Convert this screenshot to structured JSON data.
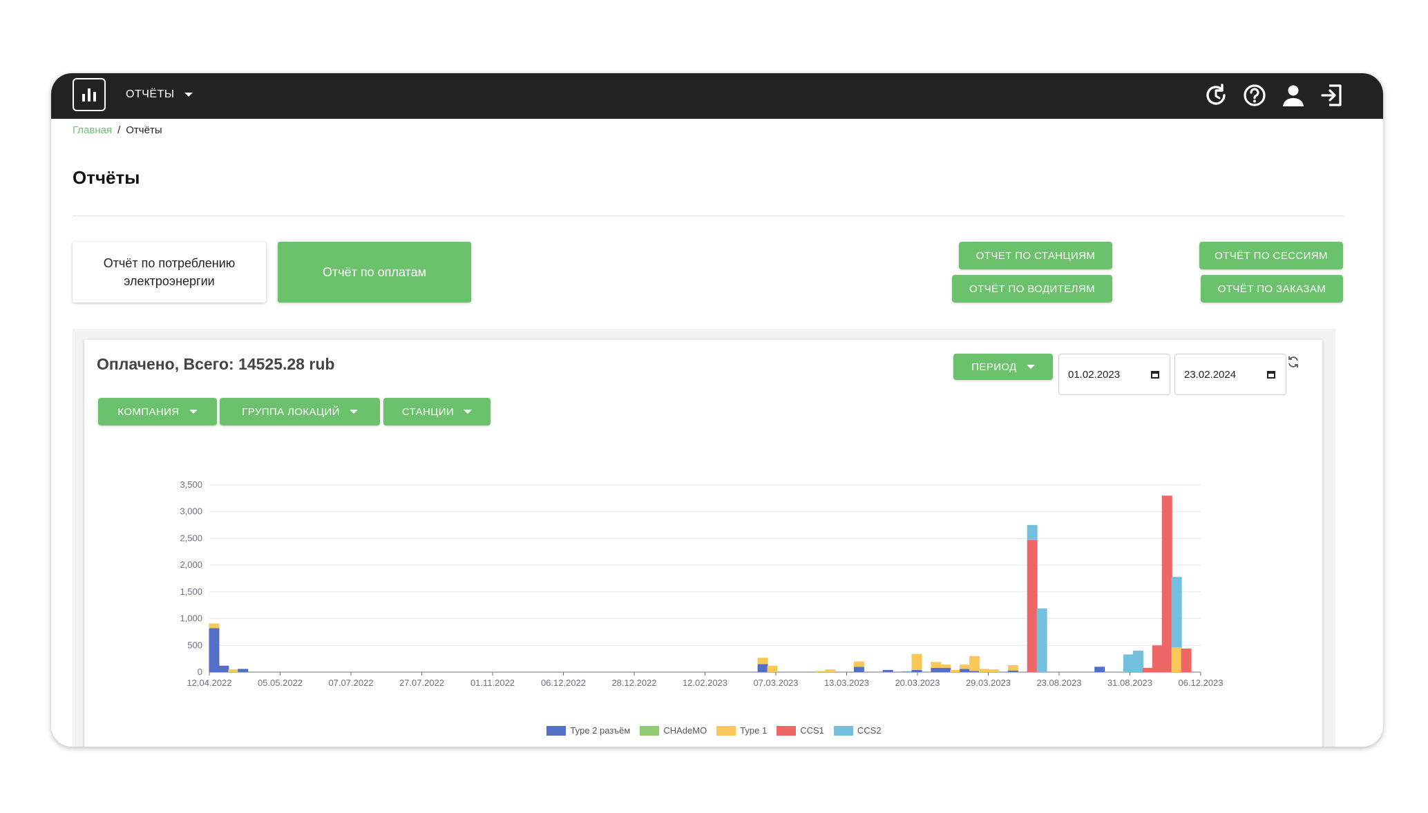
{
  "header": {
    "menu_label": "ОТЧЁТЫ",
    "icons": [
      "history-icon",
      "help-icon",
      "user-icon",
      "logout-icon"
    ]
  },
  "breadcrumb": {
    "home": "Главная",
    "separator": "/",
    "current": "Отчёты"
  },
  "page_title": "Отчёты",
  "tabs": {
    "energy": "Отчёт по потреблению электроэнергии",
    "payments": "Отчёт по оплатам"
  },
  "buttons": {
    "stations": "ОТЧЕТ ПО СТАНЦИЯМ",
    "drivers": "ОТЧЁТ ПО ВОДИТЕЛЯМ",
    "sessions": "ОТЧЁТ ПО СЕССИЯМ",
    "orders": "ОТЧЁТ ПО ЗАКАЗАМ"
  },
  "panel": {
    "title": "Оплачено, Всего: 14525.28 rub",
    "period_label": "ПЕРИОД",
    "date_from": "01.02.2023",
    "date_to": "23.02.2024",
    "filters": {
      "company": "КОМПАНИЯ",
      "location_group": "ГРУППА ЛОКАЦИЙ",
      "stations": "СТАНЦИИ"
    }
  },
  "colors": {
    "accent": "#6cc16c",
    "topbar": "#222222"
  },
  "chart_data": {
    "type": "bar",
    "stacked": true,
    "ylim": [
      0,
      3500
    ],
    "yticks": [
      0,
      500,
      1000,
      1500,
      2000,
      2500,
      3000,
      3500
    ],
    "ytick_labels": [
      "0",
      "500",
      "1,000",
      "1,500",
      "2,000",
      "2,500",
      "3,000",
      "3,500"
    ],
    "xtick_labels": [
      "12.04.2022",
      "05.05.2022",
      "07.07.2022",
      "27.07.2022",
      "01.11.2022",
      "06.12.2022",
      "28.12.2022",
      "12.02.2023",
      "07.03.2023",
      "13.03.2023",
      "20.03.2023",
      "29.03.2023",
      "23.08.2023",
      "31.08.2023",
      "06.12.2023"
    ],
    "grid": true,
    "legend_position": "bottom",
    "series": [
      {
        "name": "Type 2 разъём",
        "color": "#5470c6",
        "values": [
          820,
          120,
          0,
          60,
          0,
          0,
          0,
          0,
          0,
          0,
          0,
          0,
          0,
          0,
          0,
          0,
          0,
          0,
          0,
          0,
          0,
          0,
          0,
          0,
          0,
          0,
          0,
          0,
          0,
          0,
          0,
          0,
          0,
          0,
          0,
          0,
          0,
          0,
          0,
          0,
          0,
          0,
          0,
          0,
          0,
          0,
          0,
          0,
          0,
          0,
          0,
          0,
          0,
          0,
          0,
          0,
          0,
          150,
          0,
          0,
          0,
          0,
          0,
          0,
          0,
          0,
          0,
          100,
          0,
          0,
          40,
          0,
          10,
          40,
          0,
          80,
          80,
          0,
          60,
          20,
          0,
          0,
          0,
          30,
          0,
          0,
          0,
          0,
          0,
          0,
          0,
          0,
          100,
          0,
          0,
          0,
          0,
          0,
          0,
          0,
          0,
          0,
          0
        ]
      },
      {
        "name": "CHAdeMO",
        "color": "#91cc75",
        "values": [
          0,
          0,
          0,
          0,
          0,
          0,
          0,
          0,
          0,
          0,
          0,
          0,
          0,
          0,
          0,
          0,
          0,
          0,
          0,
          0,
          0,
          0,
          0,
          0,
          0,
          0,
          0,
          0,
          0,
          0,
          0,
          0,
          0,
          0,
          0,
          0,
          0,
          0,
          0,
          0,
          0,
          0,
          0,
          0,
          0,
          0,
          0,
          0,
          0,
          0,
          0,
          0,
          0,
          0,
          0,
          0,
          0,
          0,
          0,
          0,
          0,
          0,
          0,
          0,
          0,
          0,
          0,
          0,
          0,
          0,
          0,
          0,
          0,
          0,
          0,
          0,
          0,
          0,
          0,
          0,
          0,
          0,
          0,
          0,
          0,
          0,
          0,
          0,
          0,
          0,
          0,
          0,
          0,
          0,
          0,
          0,
          0,
          0,
          0,
          0,
          0,
          0,
          0
        ]
      },
      {
        "name": "Type 1",
        "color": "#fac858",
        "values": [
          90,
          0,
          50,
          0,
          0,
          0,
          0,
          0,
          0,
          0,
          0,
          0,
          0,
          0,
          0,
          0,
          0,
          0,
          0,
          0,
          0,
          0,
          0,
          0,
          0,
          0,
          0,
          0,
          0,
          0,
          0,
          0,
          0,
          0,
          0,
          0,
          0,
          0,
          0,
          0,
          0,
          0,
          0,
          0,
          0,
          0,
          0,
          0,
          0,
          0,
          0,
          0,
          0,
          0,
          0,
          0,
          0,
          120,
          120,
          0,
          0,
          0,
          0,
          20,
          50,
          0,
          0,
          100,
          0,
          0,
          0,
          0,
          0,
          300,
          0,
          110,
          60,
          40,
          80,
          280,
          60,
          50,
          0,
          100,
          0,
          0,
          0,
          0,
          0,
          0,
          0,
          0,
          0,
          0,
          0,
          0,
          0,
          0,
          0,
          0,
          460,
          0,
          0
        ]
      },
      {
        "name": "CCS1",
        "color": "#ee6666",
        "values": [
          0,
          0,
          0,
          0,
          0,
          0,
          0,
          0,
          0,
          0,
          0,
          0,
          0,
          0,
          0,
          0,
          0,
          0,
          0,
          0,
          0,
          0,
          0,
          0,
          0,
          0,
          0,
          0,
          0,
          0,
          0,
          0,
          0,
          0,
          0,
          0,
          0,
          0,
          0,
          0,
          0,
          0,
          0,
          0,
          0,
          0,
          0,
          0,
          0,
          0,
          0,
          0,
          0,
          0,
          0,
          0,
          0,
          0,
          0,
          0,
          0,
          0,
          0,
          0,
          0,
          0,
          0,
          0,
          0,
          0,
          0,
          0,
          0,
          0,
          0,
          0,
          0,
          0,
          0,
          0,
          0,
          0,
          0,
          0,
          0,
          2470,
          0,
          0,
          0,
          0,
          0,
          0,
          0,
          0,
          0,
          0,
          0,
          80,
          500,
          3300,
          0,
          440,
          0
        ]
      },
      {
        "name": "CCS2",
        "color": "#73c0de",
        "values": [
          0,
          0,
          0,
          0,
          0,
          0,
          0,
          0,
          0,
          0,
          0,
          0,
          0,
          0,
          0,
          0,
          0,
          0,
          0,
          0,
          0,
          0,
          0,
          0,
          0,
          0,
          0,
          0,
          0,
          0,
          0,
          0,
          0,
          0,
          0,
          0,
          0,
          0,
          0,
          0,
          0,
          0,
          0,
          0,
          0,
          0,
          0,
          0,
          0,
          0,
          0,
          0,
          0,
          0,
          0,
          0,
          0,
          0,
          0,
          0,
          0,
          0,
          0,
          0,
          0,
          0,
          0,
          0,
          0,
          0,
          0,
          0,
          0,
          0,
          0,
          0,
          0,
          0,
          0,
          0,
          0,
          0,
          0,
          0,
          0,
          280,
          1190,
          0,
          0,
          0,
          0,
          0,
          0,
          0,
          0,
          330,
          400,
          0,
          0,
          0,
          1320,
          0,
          0
        ]
      }
    ]
  }
}
